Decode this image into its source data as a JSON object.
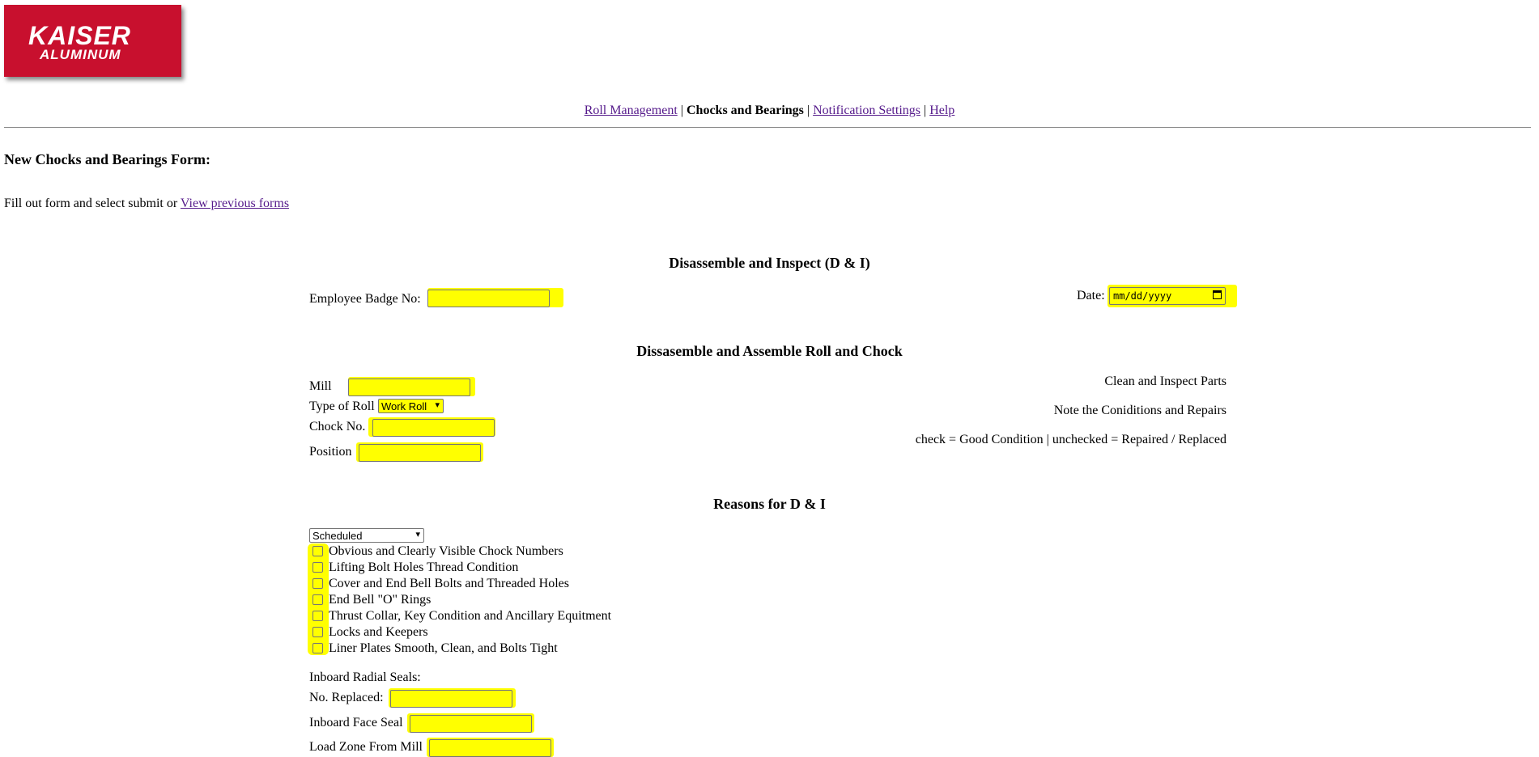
{
  "logo": {
    "line1": "KAISER",
    "line2": "ALUMINUM"
  },
  "nav": {
    "items": [
      {
        "label": "Roll Management"
      },
      {
        "label": "Chocks and Bearings"
      },
      {
        "label": "Notification Settings"
      },
      {
        "label": "Help"
      }
    ],
    "separator": "|"
  },
  "page": {
    "heading": "New Chocks and Bearings Form:",
    "intro_text": "Fill out form and select submit or",
    "intro_link": "View previous forms"
  },
  "section1": {
    "title": "Disassemble and Inspect (D & I)",
    "badge_label": "Employee Badge No:",
    "date_label": "Date:",
    "date_placeholder": "mm/dd/yyyy"
  },
  "section2": {
    "title": "Dissasemble and Assemble Roll and Chock",
    "mill_label": "Mill",
    "roll_type_label": "Type of Roll",
    "roll_type_value": "Work Roll",
    "chock_label": "Chock No.",
    "position_label": "Position",
    "right_lines": [
      "Clean and Inspect Parts",
      "Note the Coniditions and Repairs",
      "check = Good Condition | unchecked = Repaired / Replaced"
    ]
  },
  "section3": {
    "title": "Reasons for D & I",
    "reason_value": "Scheduled",
    "checks": [
      "Obvious and Clearly Visible Chock Numbers",
      "Lifting Bolt Holes Thread Condition",
      "Cover and End Bell Bolts and Threaded Holes",
      "End Bell \"O\" Rings",
      "Thrust Collar, Key Condition and Ancillary Equitment",
      "Locks and Keepers",
      "Liner Plates Smooth, Clean, and Bolts Tight"
    ],
    "inboard_radial_label": "Inboard Radial Seals:",
    "no_replaced_label": "No. Replaced:",
    "inboard_face_label": "Inboard Face Seal",
    "load_zone_label": "Load Zone From Mill"
  },
  "colors": {
    "highlight": "#ffff00",
    "logo_red": "#c8102e",
    "link": "#551a8b"
  }
}
